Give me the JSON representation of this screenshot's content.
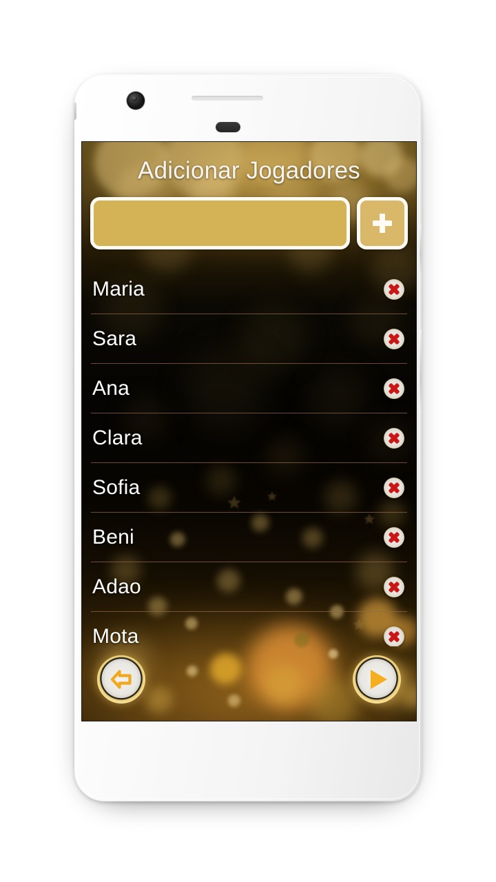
{
  "device": {
    "type": "white-smartphone",
    "camera_icon": "front-camera-icon",
    "speaker_icon": "earpiece-speaker-icon",
    "sensor_icon": "proximity-sensor-icon"
  },
  "screen": {
    "title": "Adicionar Jogadores",
    "background_style": "golden-bokeh",
    "colors": {
      "accent_gold": "#d3b355",
      "button_gold": "#d9b969",
      "border_white": "#fdfbf4",
      "separator": "#946848",
      "remove_x_red": "#cc1616",
      "arrow_orange": "#f0a81e",
      "text_white": "#ffffff"
    }
  },
  "add_player": {
    "input_value": "",
    "input_placeholder": "",
    "add_button_label": "+",
    "add_button_icon": "plus-icon"
  },
  "players": [
    {
      "name": "Maria",
      "remove_icon": "remove-circle-x-icon"
    },
    {
      "name": "Sara",
      "remove_icon": "remove-circle-x-icon"
    },
    {
      "name": "Ana",
      "remove_icon": "remove-circle-x-icon"
    },
    {
      "name": "Clara",
      "remove_icon": "remove-circle-x-icon"
    },
    {
      "name": "Sofia",
      "remove_icon": "remove-circle-x-icon"
    },
    {
      "name": "Beni",
      "remove_icon": "remove-circle-x-icon"
    },
    {
      "name": "Adao",
      "remove_icon": "remove-circle-x-icon"
    },
    {
      "name": "Mota",
      "remove_icon": "remove-circle-x-icon"
    }
  ],
  "bottom_nav": {
    "back": {
      "icon": "arrow-left-icon",
      "label": ""
    },
    "play": {
      "icon": "play-icon",
      "label": ""
    }
  }
}
